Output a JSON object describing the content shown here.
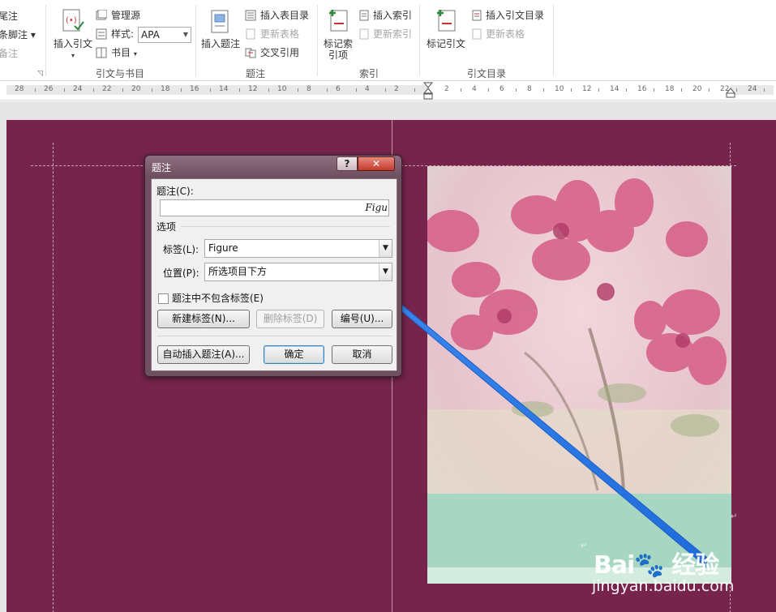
{
  "ribbon": {
    "footnotes_group": {
      "insert_endnote": "尾注",
      "next_footnote": "下一条脚注",
      "show_notes": "显示备注"
    },
    "citations_group": {
      "insert_citation": "插入引文",
      "manage_sources": "管理源",
      "style_label": "样式:",
      "style_value": "APA",
      "bibliography": "书目",
      "group_label": "引文与书目"
    },
    "captions_group": {
      "insert_caption": "插入题注",
      "insert_table_of_figures": "插入表目录",
      "update_table": "更新表格",
      "cross_reference": "交叉引用",
      "group_label": "题注"
    },
    "index_group": {
      "mark_entry": "标记索引项",
      "insert_index": "插入索引",
      "update_index": "更新索引",
      "group_label": "索引"
    },
    "toa_group": {
      "mark_citation": "标记引文",
      "insert_toa": "插入引文目录",
      "update_table": "更新表格",
      "group_label": "引文目录"
    }
  },
  "ruler": {
    "left_numbers": [
      "28",
      "26",
      "24",
      "22",
      "20",
      "18",
      "16",
      "14",
      "12",
      "10",
      "8",
      "6",
      "4",
      "2"
    ],
    "right_numbers": [
      "2",
      "4",
      "6",
      "8",
      "10",
      "12",
      "14",
      "16",
      "18",
      "20",
      "22",
      "24"
    ]
  },
  "dialog": {
    "title": "题注",
    "help_button": "?",
    "close_button": "✕",
    "caption_label": "题注(C):",
    "caption_value": "Figu",
    "options_label": "选项",
    "label_label": "标签(L):",
    "label_value": "Figure",
    "position_label": "位置(P):",
    "position_value": "所选项目下方",
    "exclude_label_checkbox": "题注中不包含标签(E)",
    "new_label_button": "新建标签(N)...",
    "delete_label_button": "删除标签(D)",
    "numbering_button": "编号(U)...",
    "autocaption_button": "自动插入题注(A)...",
    "ok_button": "确定",
    "cancel_button": "取消"
  },
  "colors": {
    "page_background": "#76244b",
    "arrow": "#2e7be8"
  }
}
